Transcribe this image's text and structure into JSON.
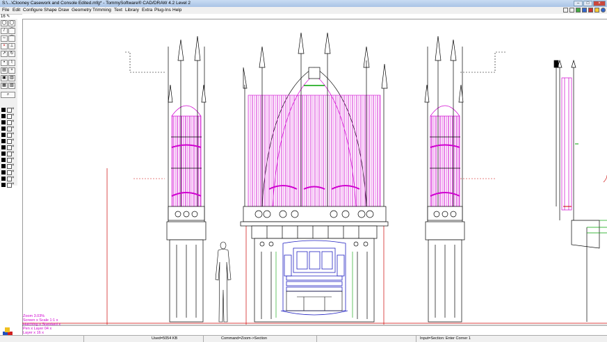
{
  "window": {
    "title": "S:\\...\\Clooney Casework and Console Edited.mfg* - TommySoftware® CAD/DRAW 4.2 Level 2",
    "controls": [
      "–",
      "□",
      "×"
    ]
  },
  "menu": [
    "File",
    "Edit",
    "Configure",
    "Shape",
    "Draw",
    "Geometry",
    "Trimming",
    "Text",
    "Library",
    "Extra",
    "Plug-Ins",
    "Help"
  ],
  "zoom_indicator": "16  ✎",
  "info_lines": [
    "Zoom 3.03%",
    "Screen x Scale 1:1 x",
    "Hatching x Standard x",
    "Pen x Layer 04 x",
    "Layer x 16 x"
  ],
  "status": {
    "used": "Used=5054 KB",
    "command": "Command=Zoom->Section",
    "input": "Input=Section: Enter Corner 1"
  },
  "colors": {
    "pipes": "#d000d0",
    "case": "#000000",
    "console": "#2020c0",
    "accent_red": "#c00000",
    "accent_green": "#00a000"
  }
}
